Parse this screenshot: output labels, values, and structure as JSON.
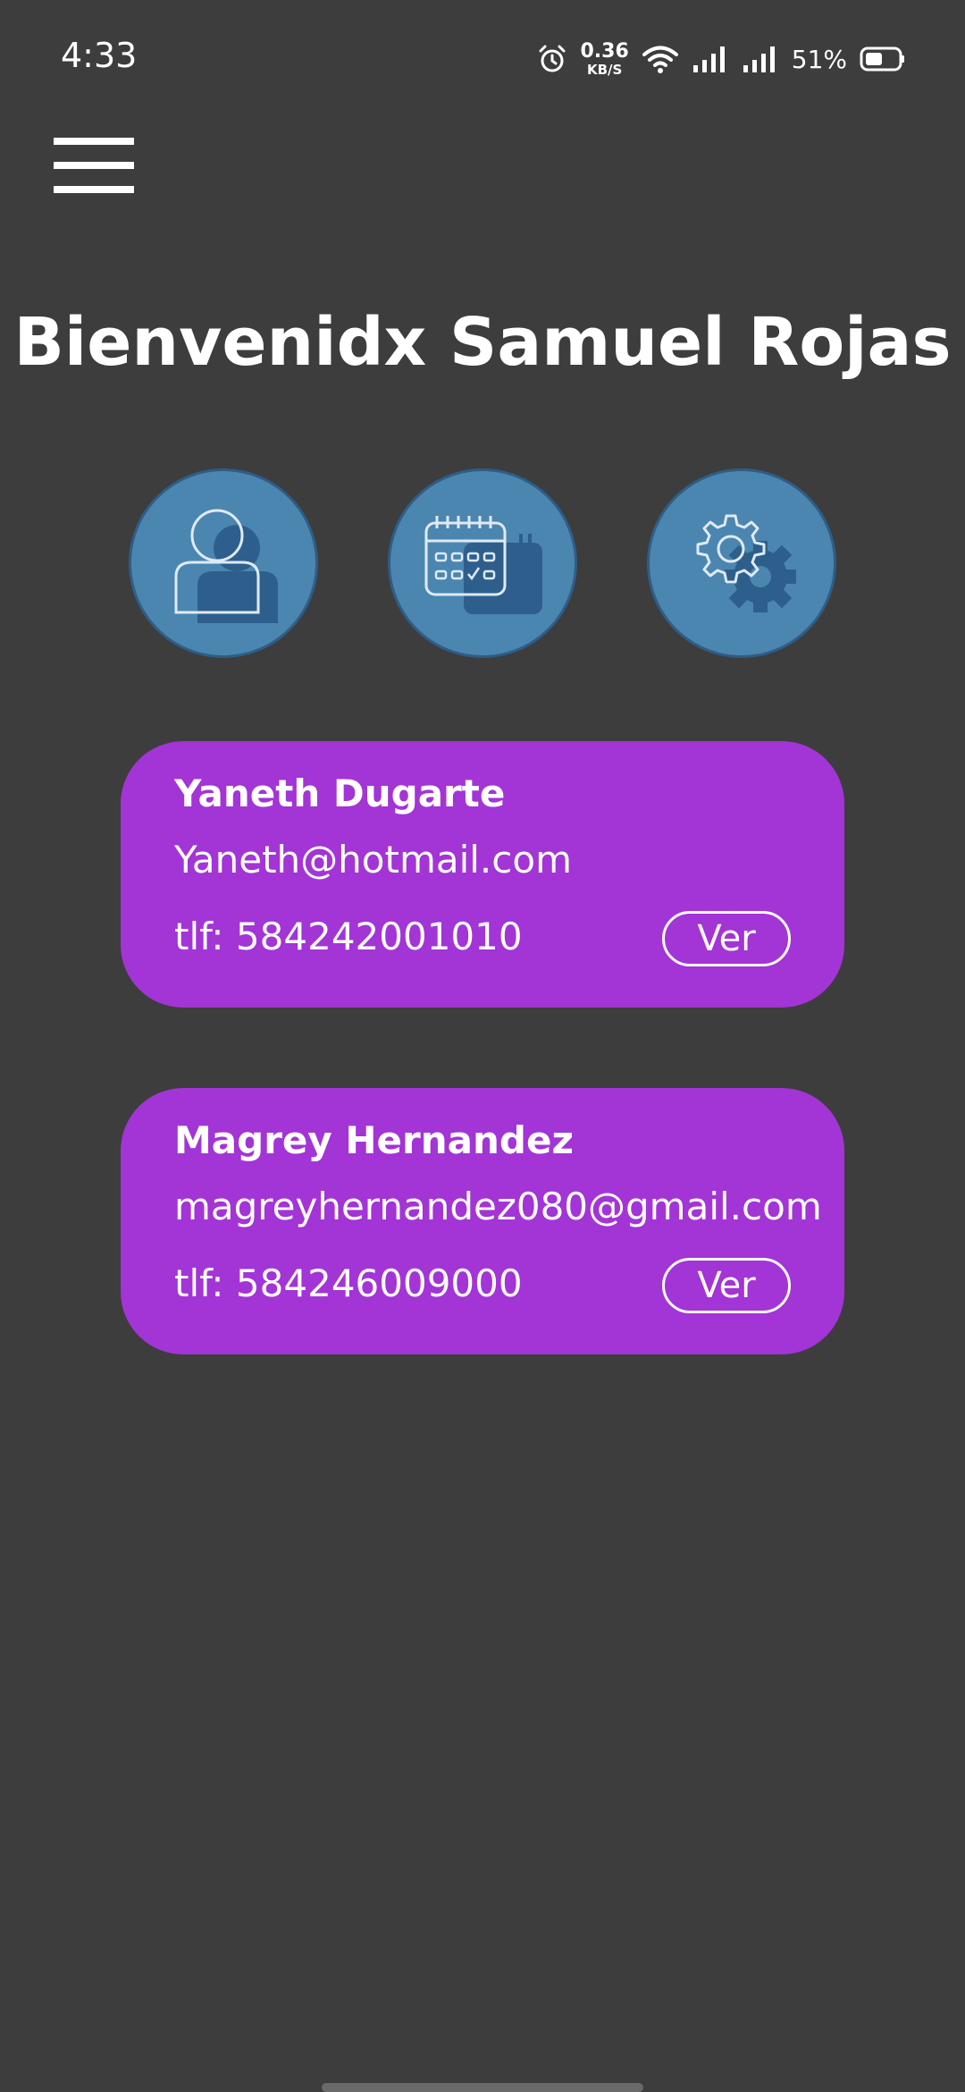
{
  "status_bar": {
    "time": "4:33",
    "net_speed_value": "0.36",
    "net_speed_unit": "KB/S",
    "battery_percent": "51%",
    "icons": [
      "alarm-icon",
      "wifi-icon",
      "signal-icon",
      "signal-icon",
      "battery-icon"
    ]
  },
  "header": {
    "menu_icon": "hamburger-menu-icon",
    "title": "Bienvenidx Samuel Rojas"
  },
  "quick_actions": [
    {
      "icon": "user-profile-icon"
    },
    {
      "icon": "calendar-icon"
    },
    {
      "icon": "settings-gear-icon"
    }
  ],
  "contacts": [
    {
      "name": "Yaneth Dugarte",
      "email": "Yaneth@hotmail.com",
      "phone": "tlf: 584242001010",
      "button": "Ver"
    },
    {
      "name": "Magrey Hernandez",
      "email": "magreyhernandez080@gmail.com",
      "phone": "tlf: 584246009000",
      "button": "Ver"
    }
  ],
  "colors": {
    "background": "#3d3d3e",
    "card": "#a334d6",
    "circle": "#4b86b0",
    "circle_border": "#2f5d86",
    "text": "#ffffff"
  }
}
